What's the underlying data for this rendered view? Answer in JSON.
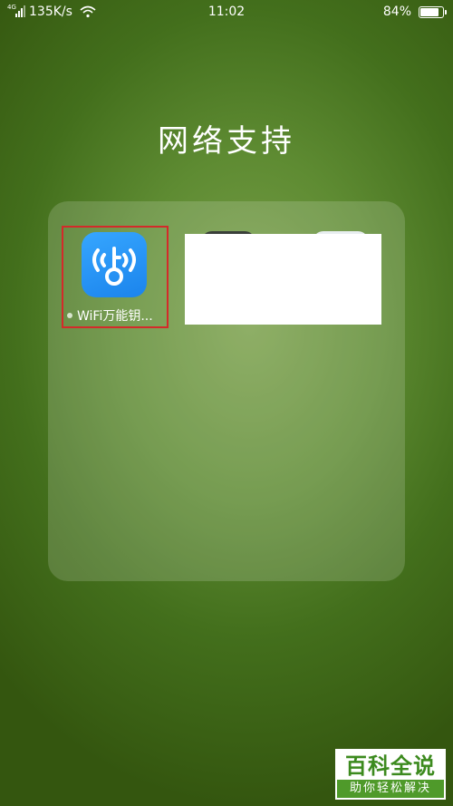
{
  "status_bar": {
    "signal_label": "4G",
    "network_speed": "135K/s",
    "time": "11:02",
    "battery_percent": "84%",
    "battery_level": 0.84
  },
  "folder": {
    "title": "网络支持",
    "apps": [
      {
        "label": "WiFi万能钥...",
        "icon": "wifi-key-icon",
        "highlighted": true,
        "new_indicator": true
      }
    ]
  },
  "watermark": {
    "title": "百科全说",
    "subtitle": "助你轻松解决"
  },
  "colors": {
    "highlight_border": "#d42a2a",
    "app_icon_blue": "#1b84ec",
    "watermark_green": "#3c8a1e"
  }
}
